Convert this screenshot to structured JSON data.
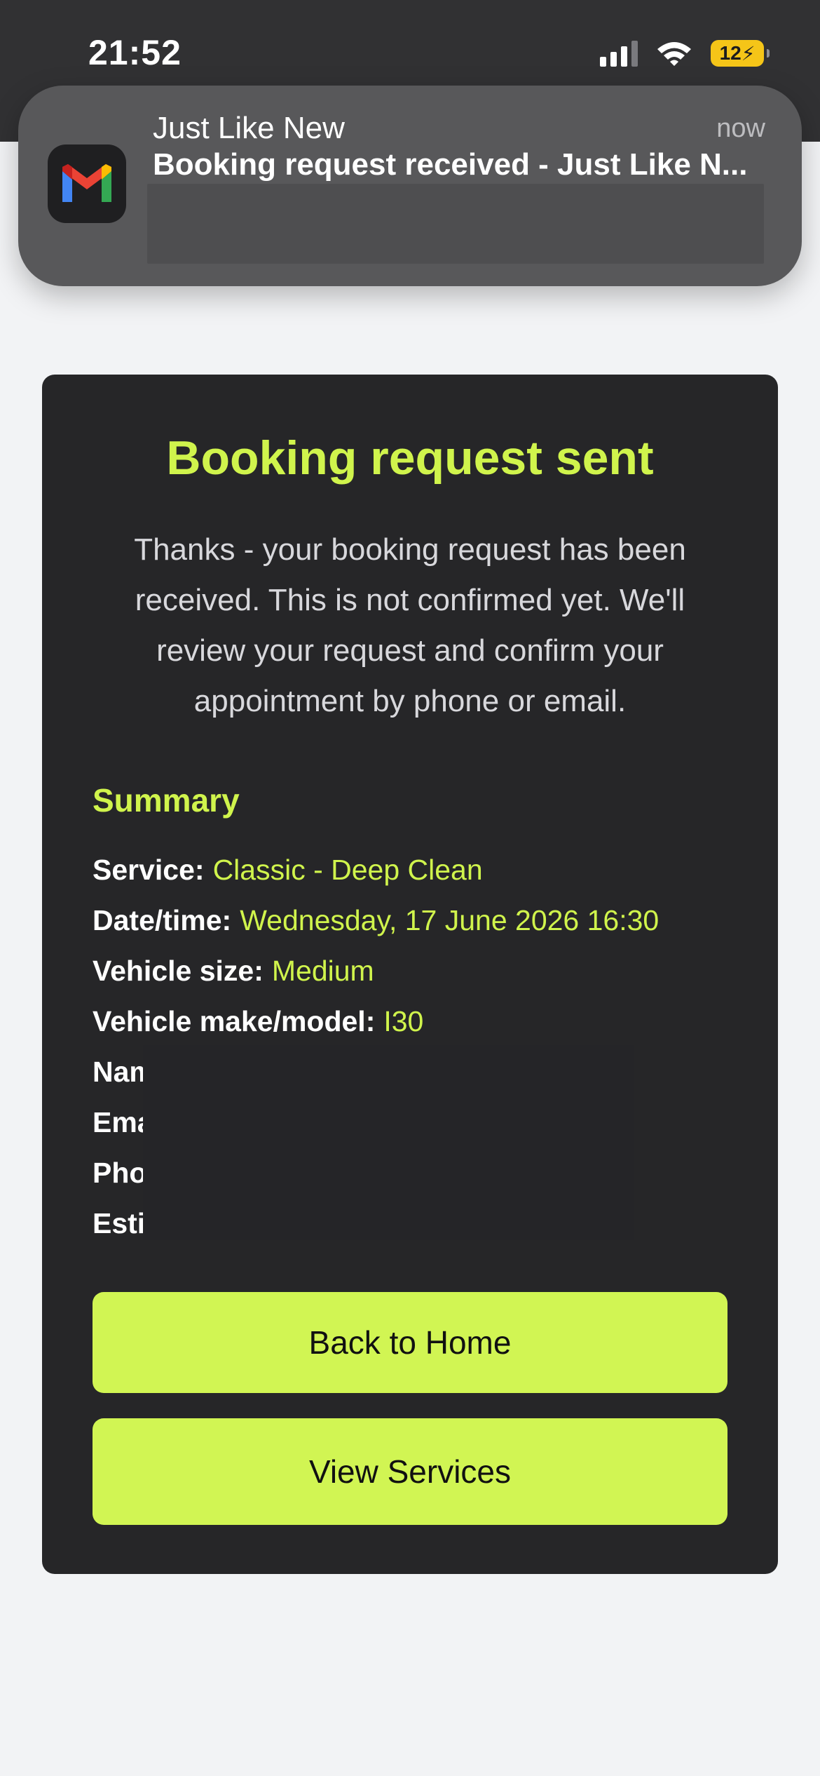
{
  "status_bar": {
    "time": "21:52",
    "battery_level": "12"
  },
  "notification": {
    "app_icon": "gmail-icon",
    "sender": "Just Like New",
    "time": "now",
    "subject": "Booking request received - Just Like N..."
  },
  "confirmation": {
    "title": "Booking request sent",
    "message": "Thanks - your booking request has been received. This is not confirmed yet. We'll review your request and confirm your appointment by phone or email.",
    "summary": {
      "heading": "Summary",
      "rows": [
        {
          "label": "Service:",
          "value": "Classic - Deep Clean"
        },
        {
          "label": "Date/time:",
          "value": "Wednesday, 17 June 2026 16:30"
        },
        {
          "label": "Vehicle size:",
          "value": "Medium"
        },
        {
          "label": "Vehicle make/model:",
          "value": "I30"
        },
        {
          "label": "Nam",
          "value": ""
        },
        {
          "label": "Ema",
          "value": ""
        },
        {
          "label": "Pho",
          "value": ""
        },
        {
          "label": "Esti",
          "value": ""
        }
      ]
    },
    "buttons": {
      "back_home": "Back to Home",
      "view_services": "View Services"
    }
  },
  "colors": {
    "accent": "#d0f44c",
    "card_background": "#262628",
    "page_background": "#f2f3f5"
  }
}
